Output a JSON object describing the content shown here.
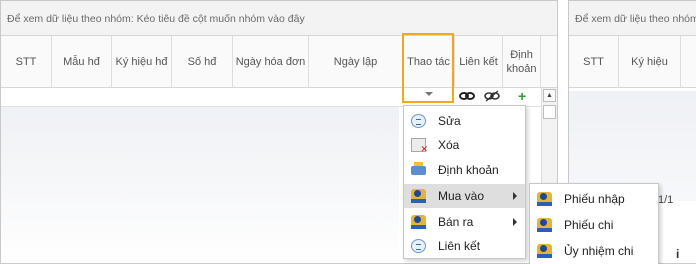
{
  "left_grid": {
    "group_hint": "Để xem dữ liệu theo nhóm: Kéo tiêu đề cột muốn nhóm vào đây",
    "columns": {
      "stt": "STT",
      "mau_hd": "Mẫu hđ",
      "ky_hieu_hd": "Ký hiệu hđ",
      "so_hd": "Số hđ",
      "ngay_hoa_don": "Ngày hóa đơn",
      "ngay_lap": "Ngày lập",
      "thao_tac": "Thao tác",
      "lien_ket": "Liên kết",
      "dinh_khoan": "Định khoản"
    },
    "row_actions": {
      "link": "link-icon",
      "unlink": "unlink-icon",
      "add": "+"
    }
  },
  "right_grid": {
    "group_hint": "Để xem dữ liệu theo nhóm",
    "columns": {
      "stt": "STT",
      "ky_hieu": "Ký hiệu"
    },
    "pager": "1/1",
    "tail_text": "i"
  },
  "context_menu": {
    "items": [
      {
        "label": "Sửa",
        "icon": "edit-icon"
      },
      {
        "label": "Xóa",
        "icon": "delete-icon"
      },
      {
        "label": "Định khoản",
        "icon": "ledger-icon"
      },
      {
        "label": "Mua vào",
        "icon": "user-icon",
        "submenu": true
      },
      {
        "label": "Bán ra",
        "icon": "user-icon",
        "submenu": true
      },
      {
        "label": "Liên kết",
        "icon": "link-doc-icon"
      }
    ]
  },
  "submenu": {
    "items": [
      {
        "label": "Phiếu nhập",
        "icon": "user-icon"
      },
      {
        "label": "Phiếu chi",
        "icon": "user-icon"
      },
      {
        "label": "Ủy nhiệm chi",
        "icon": "user-icon"
      }
    ]
  },
  "colors": {
    "highlight_border": "#f0a81c",
    "add_green": "#2e9b3a"
  }
}
